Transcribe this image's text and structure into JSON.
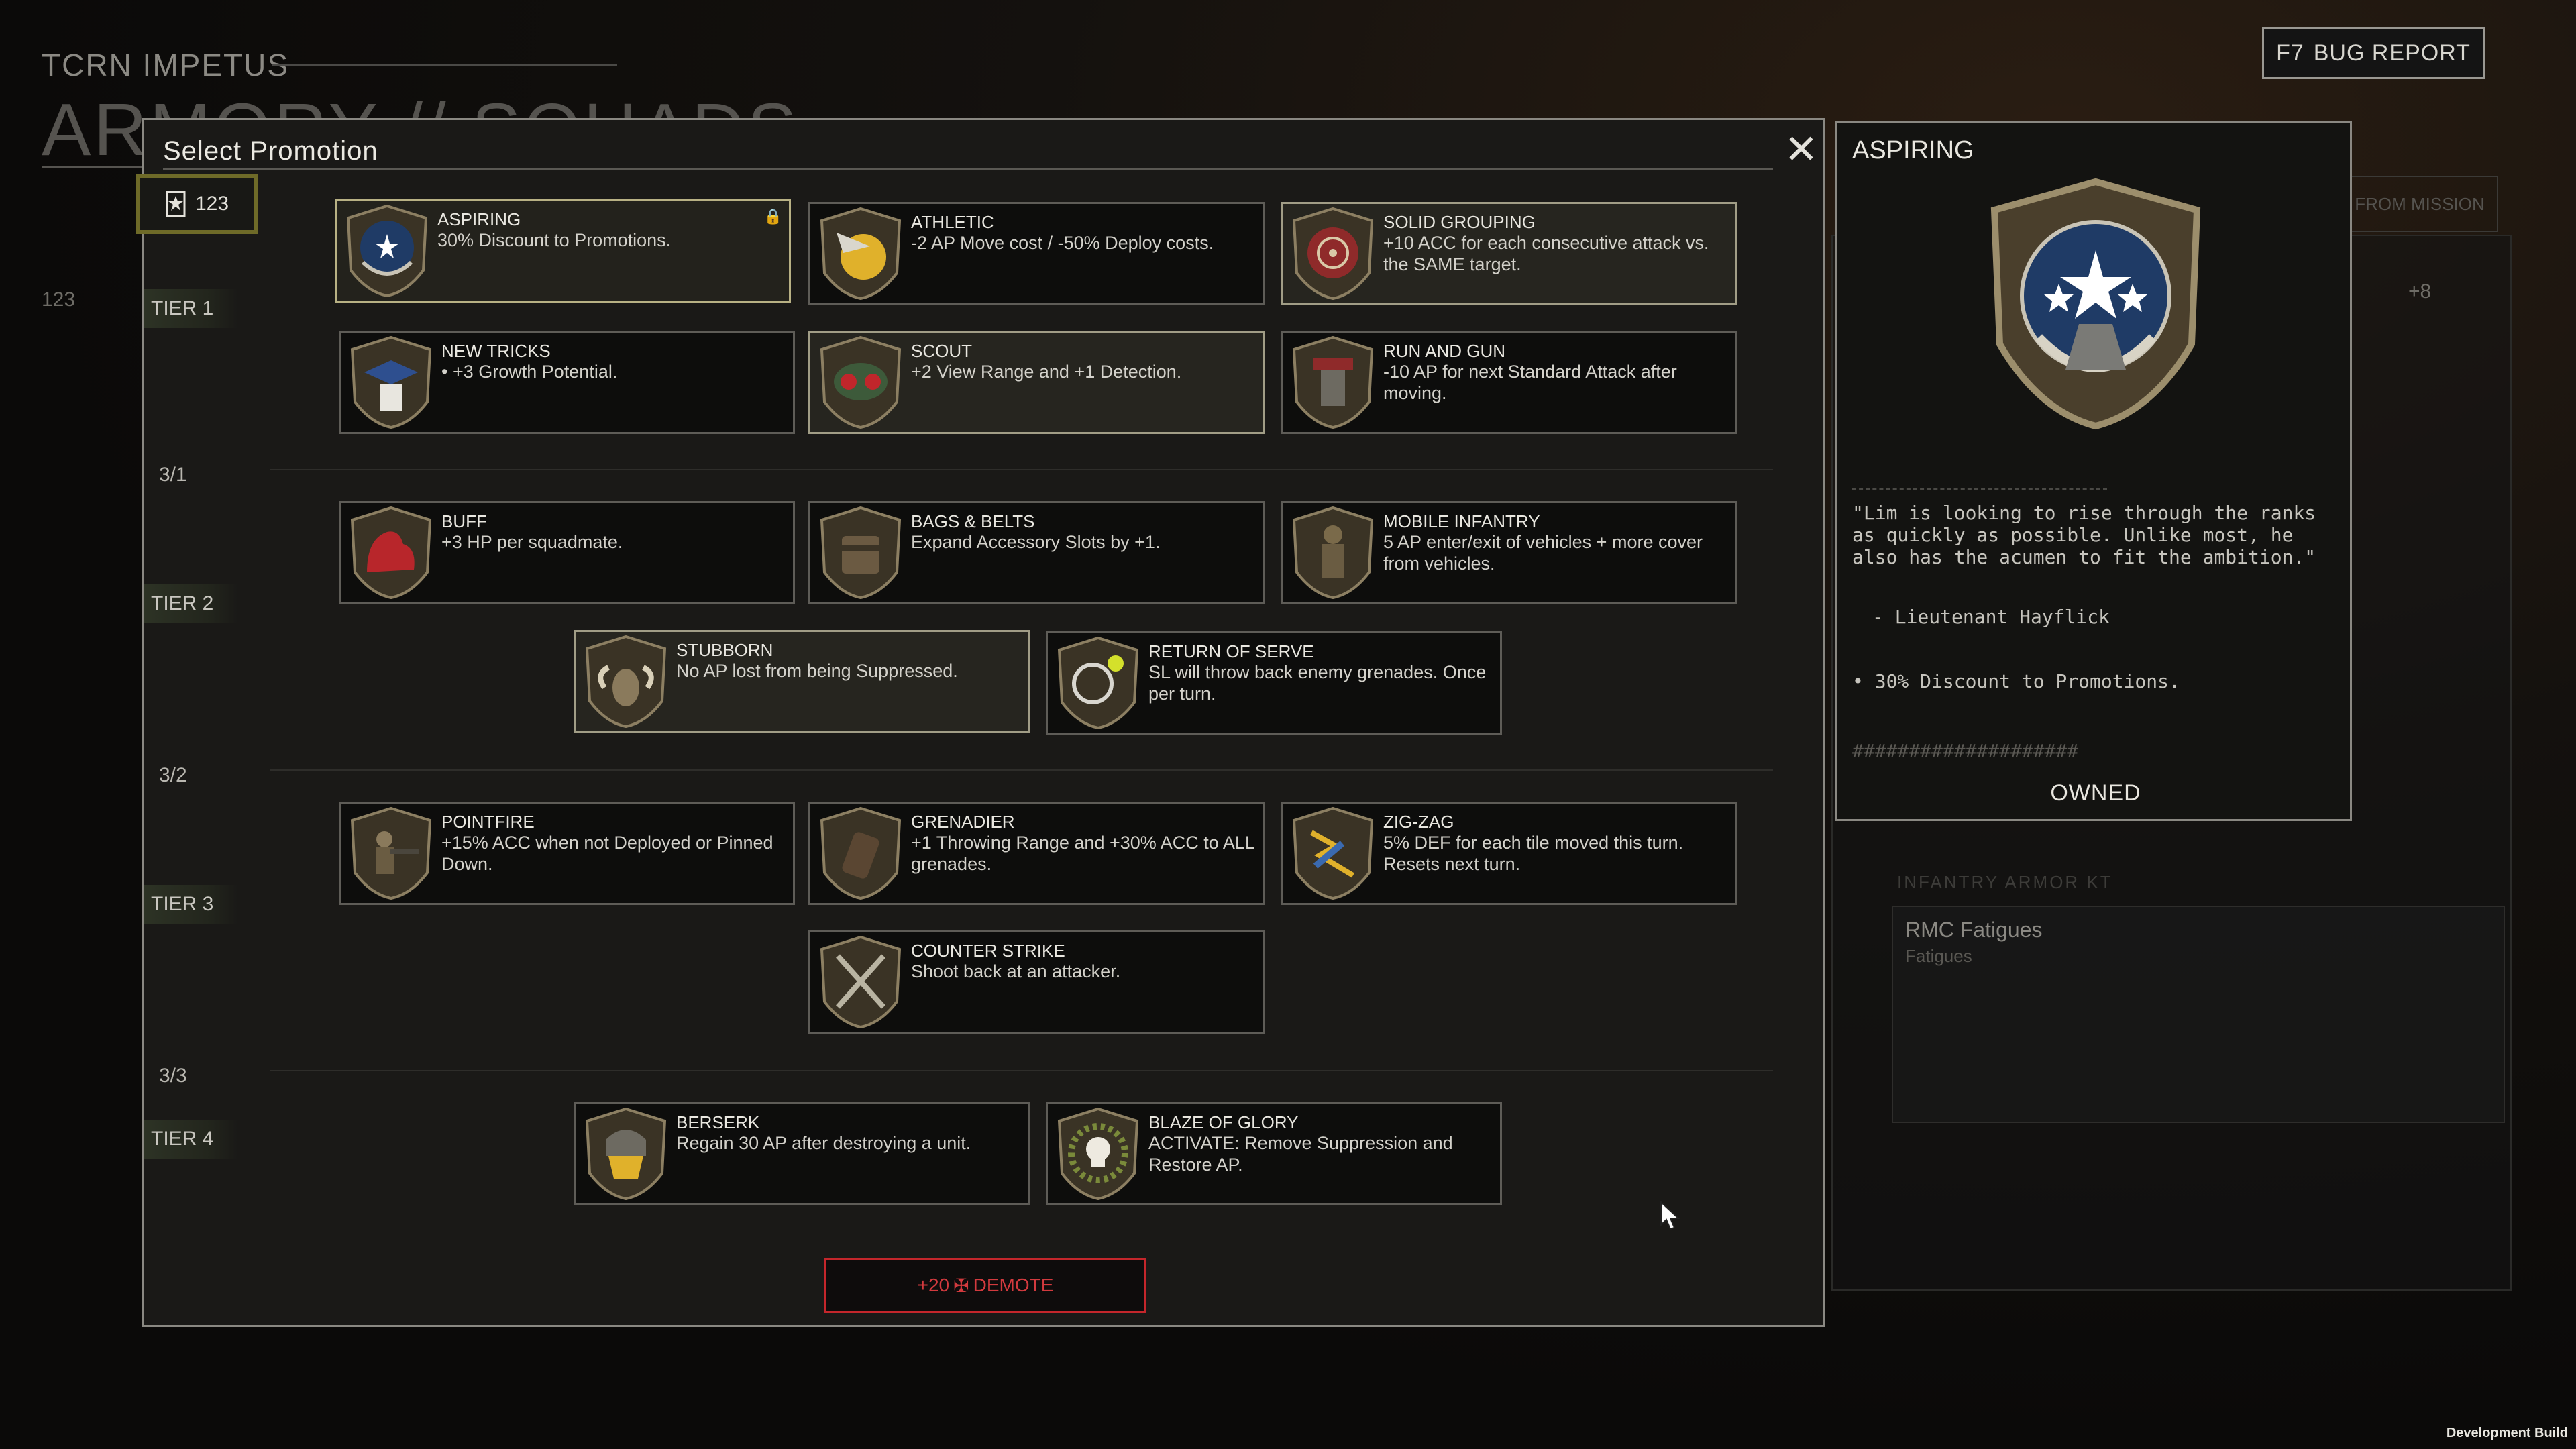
{
  "background": {
    "ship_title": "TCRN IMPETUS",
    "screen_title": "ARMORY // SQUADS",
    "squad_points": "123",
    "from_mission": "FROM MISSION",
    "upgrade_count": "+8",
    "infantry_armor": "INFANTRY ARMOR KT",
    "fatigues_title": "RMC Fatigues",
    "fatigues_sub": "Fatigues"
  },
  "bug_report": {
    "key": "F7",
    "label": "BUG REPORT"
  },
  "dev_build": "Development Build",
  "modal": {
    "title": "Select Promotion",
    "points": "123",
    "tiers": [
      "TIER 1",
      "TIER 2",
      "TIER 3",
      "TIER 4"
    ],
    "progress": [
      "3/1",
      "3/2",
      "3/3"
    ],
    "demote_label": "+20",
    "demote_text": "DEMOTE"
  },
  "promotions": [
    {
      "name": "ASPIRING",
      "desc": "30% Discount to Promotions.",
      "icon": "aspiring-icon"
    },
    {
      "name": "ATHLETIC",
      "desc": "-2 AP Move cost / -50% Deploy costs.",
      "icon": "athletic-icon"
    },
    {
      "name": "SOLID GROUPING",
      "desc": "+10 ACC for each consecutive attack vs. the SAME target.",
      "icon": "solid-grouping-icon"
    },
    {
      "name": "NEW TRICKS",
      "desc": "• +3 Growth Potential.",
      "icon": "new-tricks-icon"
    },
    {
      "name": "SCOUT",
      "desc": "+2 View Range and +1 Detection.",
      "icon": "scout-icon"
    },
    {
      "name": "RUN AND GUN",
      "desc": "-10 AP for next Standard Attack after moving.",
      "icon": "run-and-gun-icon"
    },
    {
      "name": "BUFF",
      "desc": "+3 HP per squadmate.",
      "icon": "buff-icon"
    },
    {
      "name": "BAGS & BELTS",
      "desc": "Expand Accessory Slots by +1.",
      "icon": "bags-belts-icon"
    },
    {
      "name": "MOBILE INFANTRY",
      "desc": "5 AP enter/exit of vehicles + more cover from vehicles.",
      "icon": "mobile-infantry-icon"
    },
    {
      "name": "STUBBORN",
      "desc": "No AP lost from being Suppressed.",
      "icon": "stubborn-icon"
    },
    {
      "name": "RETURN OF SERVE",
      "desc": "SL will throw back enemy grenades. Once per turn.",
      "icon": "return-of-serve-icon"
    },
    {
      "name": "POINTFIRE",
      "desc": "+15% ACC when not Deployed or Pinned Down.",
      "icon": "pointfire-icon"
    },
    {
      "name": "GRENADIER",
      "desc": "+1 Throwing Range and +30% ACC to ALL grenades.",
      "icon": "grenadier-icon"
    },
    {
      "name": "ZIG-ZAG",
      "desc": "5% DEF for each tile moved this turn. Resets next turn.",
      "icon": "zig-zag-icon"
    },
    {
      "name": "COUNTER STRIKE",
      "desc": "Shoot back at an attacker.",
      "icon": "counter-strike-icon"
    },
    {
      "name": "BERSERK",
      "desc": "Regain 30 AP after destroying a unit.",
      "icon": "berserk-icon"
    },
    {
      "name": "BLAZE OF GLORY",
      "desc": "ACTIVATE: Remove Suppression and Restore AP.",
      "icon": "blaze-of-glory-icon"
    }
  ],
  "detail": {
    "title": "ASPIRING",
    "quote": "\"Lim is looking to rise through the ranks as quickly as possible. Unlike most, he also has the acumen to fit the ambition.\"",
    "author": "- Lieutenant Hayflick",
    "bullet": "• 30% Discount to Promotions.",
    "hash": "####################",
    "status": "OWNED"
  },
  "colors": {
    "owned_border": "#b8b184",
    "demote_red": "#c4262b",
    "tier_bg": "#2d3325"
  }
}
